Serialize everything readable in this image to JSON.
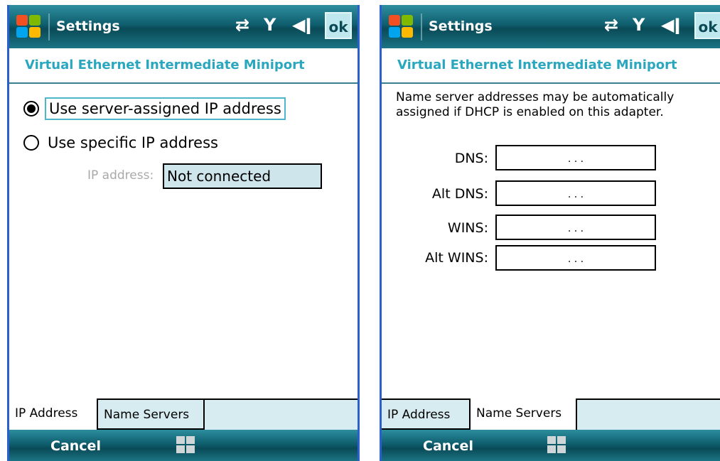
{
  "screen1": {
    "title": "Settings",
    "ok": "ok",
    "subtitle": "Virtual Ethernet Intermediate Miniport",
    "radio_server": "Use server-assigned IP address",
    "radio_specific": "Use specific IP address",
    "ip_label": "IP address:",
    "ip_value": "Not connected",
    "tabs": [
      "IP Address",
      "Name Servers"
    ],
    "cancel": "Cancel"
  },
  "screen2": {
    "title": "Settings",
    "ok": "ok",
    "subtitle": "Virtual Ethernet Intermediate Miniport",
    "description": "Name server addresses may be automatically assigned if DHCP is enabled on this adapter.",
    "fields": [
      {
        "label": "DNS:",
        "dots": ". . ."
      },
      {
        "label": "Alt DNS:",
        "dots": ". . ."
      },
      {
        "label": "WINS:",
        "dots": ". . ."
      },
      {
        "label": "Alt WINS:",
        "dots": ". . ."
      }
    ],
    "tabs": [
      "IP Address",
      "Name Servers"
    ],
    "cancel": "Cancel"
  },
  "status_icons": [
    "sync-arrows-icon",
    "signal-antenna-icon",
    "speaker-icon"
  ],
  "colors": {
    "titlebar": "#0f5e6e",
    "accent_text": "#2aa7bf",
    "ip_box": "#cfe5ec",
    "tabbar": "#d6ecf1",
    "frame_border": "#2b5fd0"
  }
}
